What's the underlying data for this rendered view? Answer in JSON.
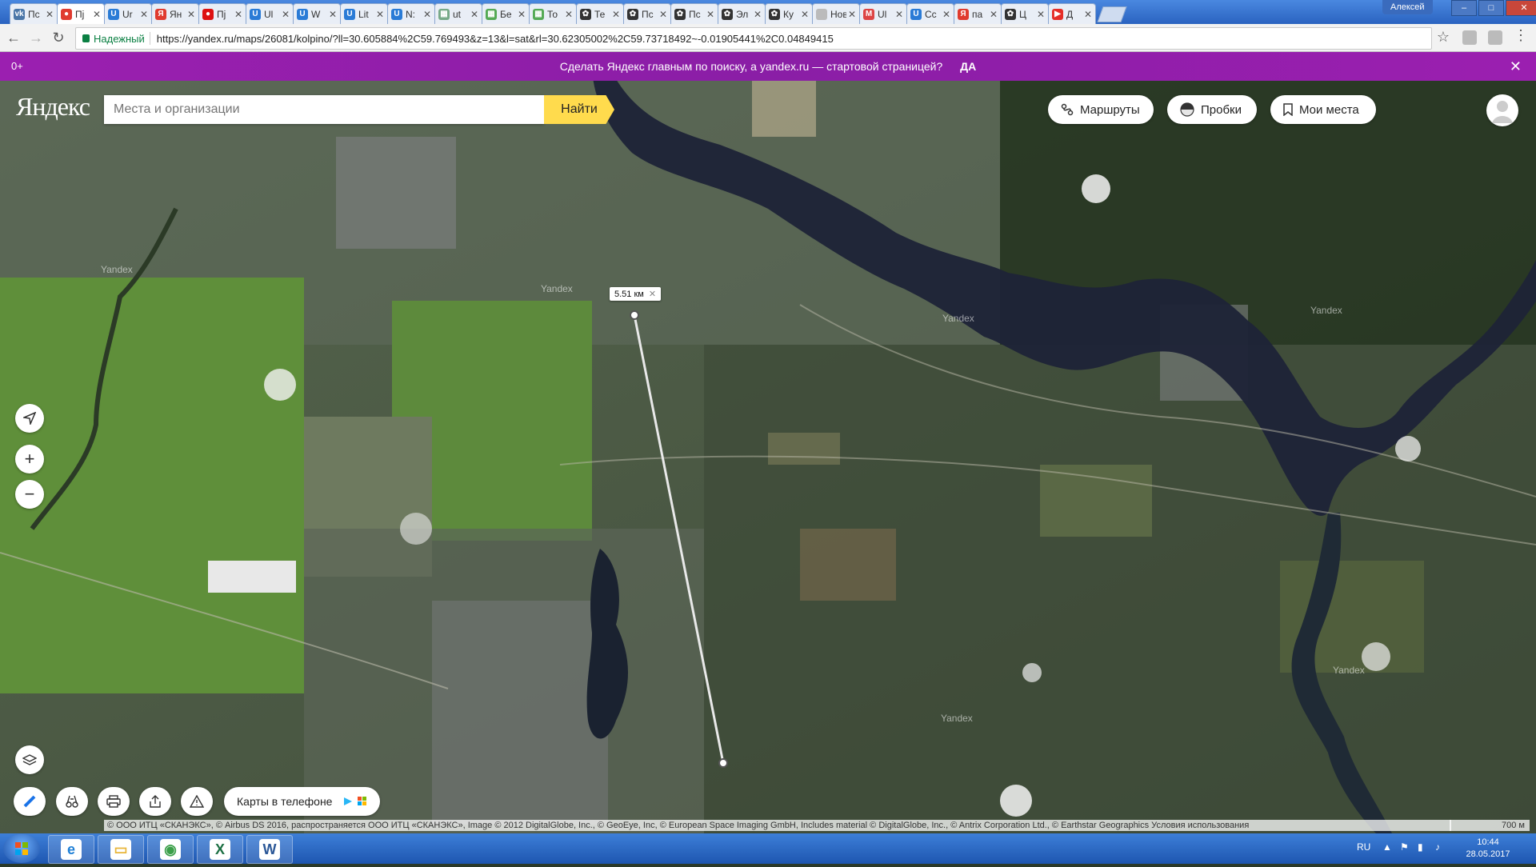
{
  "browser": {
    "tabs": [
      {
        "label": "Пс",
        "icon": "vk-icon",
        "color": "#4a76a8",
        "glyph": "vk"
      },
      {
        "label": "Пј",
        "icon": "yandex-maps-icon",
        "color": "#e03b2f",
        "glyph": "●"
      },
      {
        "label": "Ur",
        "icon": "ucoz-icon",
        "color": "#2a7bd6",
        "glyph": "U"
      },
      {
        "label": "Ян",
        "icon": "yandex-icon",
        "color": "#e03b2f",
        "glyph": "Я"
      },
      {
        "label": "Пј",
        "icon": "red-pin-icon",
        "color": "#d11",
        "glyph": "●"
      },
      {
        "label": "Ul",
        "icon": "ucoz-icon",
        "color": "#2a7bd6",
        "glyph": "U"
      },
      {
        "label": "W",
        "icon": "ucoz-icon",
        "color": "#2a7bd6",
        "glyph": "U"
      },
      {
        "label": "Lit",
        "icon": "ucoz-icon",
        "color": "#2a7bd6",
        "glyph": "U"
      },
      {
        "label": "N:",
        "icon": "ucoz-icon",
        "color": "#2a7bd6",
        "glyph": "U"
      },
      {
        "label": "ut",
        "icon": "grid-icon",
        "color": "#7a8",
        "glyph": "▦"
      },
      {
        "label": "Бе",
        "icon": "grid-icon",
        "color": "#5a5",
        "glyph": "▦"
      },
      {
        "label": "То",
        "icon": "grid-icon",
        "color": "#5a5",
        "glyph": "▦"
      },
      {
        "label": "Те",
        "icon": "paw-icon",
        "color": "#333",
        "glyph": "✿"
      },
      {
        "label": "Пс",
        "icon": "paw-icon",
        "color": "#333",
        "glyph": "✿"
      },
      {
        "label": "Пс",
        "icon": "paw-icon",
        "color": "#333",
        "glyph": "✿"
      },
      {
        "label": "Эл",
        "icon": "paw-icon",
        "color": "#333",
        "glyph": "✿"
      },
      {
        "label": "Ку",
        "icon": "paw-icon",
        "color": "#333",
        "glyph": "✿"
      },
      {
        "label": "Новая",
        "icon": "blank-icon",
        "color": "#bbb",
        "glyph": ""
      },
      {
        "label": "Ul",
        "icon": "gmail-icon",
        "color": "#d44",
        "glyph": "M"
      },
      {
        "label": "Сс",
        "icon": "ucoz-icon",
        "color": "#2a7bd6",
        "glyph": "U"
      },
      {
        "label": "па",
        "icon": "yandex-icon",
        "color": "#e03b2f",
        "glyph": "Я"
      },
      {
        "label": "Ц",
        "icon": "paw-icon",
        "color": "#333",
        "glyph": "✿"
      },
      {
        "label": "Д",
        "icon": "youtube-icon",
        "color": "#e52d27",
        "glyph": "▶"
      }
    ],
    "active_tab": 1,
    "user_name": "Алексей",
    "security_label": "Надежный",
    "url": "https://yandex.ru/maps/26081/kolpino/?ll=30.605884%2C59.769493&z=13&l=sat&rl=30.62305002%2C59.73718492~-0.01905441%2C0.04849415"
  },
  "promo": {
    "age_label": "0+",
    "message": "Сделать Яндекс главным по поиску, а yandex.ru — стартовой страницей?",
    "yes_label": "ДА"
  },
  "map": {
    "logo": "Яндекс",
    "search_placeholder": "Места и организации",
    "find_label": "Найти",
    "routes_label": "Маршруты",
    "traffic_label": "Пробки",
    "my_places_label": "Мои места",
    "distance_label": "5.51 км",
    "apps_label": "Карты в телефоне",
    "watermark": "Yandex",
    "copyright": "© ООО ИТЦ «СКАНЭКС», © Airbus DS 2016, распространяется ООО ИТЦ «СКАНЭКС», Image © 2012 DigitalGlobe, Inc., © GeoEye, Inc, © European Space Imaging GmbH, Includes material © DigitalGlobe, Inc., © Antrix Corporation Ltd., © Earthstar Geographics Условия использования",
    "scale_label": "700 м"
  },
  "taskbar": {
    "apps": [
      {
        "name": "ie",
        "glyph": "e",
        "color": "#1e7fd6"
      },
      {
        "name": "explorer",
        "glyph": "▭",
        "color": "#e8b63a"
      },
      {
        "name": "chrome",
        "glyph": "◉",
        "color": "#3b9f49"
      },
      {
        "name": "excel",
        "glyph": "X",
        "color": "#1d7044"
      },
      {
        "name": "word",
        "glyph": "W",
        "color": "#2b5797"
      }
    ],
    "language": "RU",
    "time": "10:44",
    "date": "28.05.2017"
  }
}
